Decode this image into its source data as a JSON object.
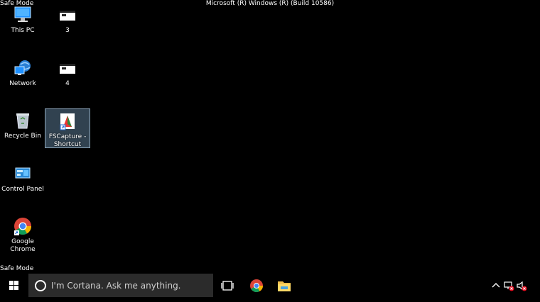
{
  "overlay": {
    "safe_mode_top": "Safe Mode",
    "safe_mode_bottom": "Safe Mode",
    "build": "Microsoft (R) Windows (R) (Build 10586)"
  },
  "desktop": {
    "icons": [
      {
        "label": "This PC",
        "icon": "computer-icon"
      },
      {
        "label": "3",
        "icon": "window-shortcut-icon"
      },
      {
        "label": "Network",
        "icon": "network-icon"
      },
      {
        "label": "4",
        "icon": "window-shortcut-icon"
      },
      {
        "label": "Recycle Bin",
        "icon": "recycle-bin-icon"
      },
      {
        "label": "FSCapture - Shortcut",
        "icon": "fscapture-icon"
      },
      {
        "label": "Control Panel",
        "icon": "control-panel-icon"
      },
      {
        "label": "Google Chrome",
        "icon": "chrome-icon"
      }
    ]
  },
  "taskbar": {
    "cortana_placeholder": "I'm Cortana. Ask me anything.",
    "accent": "#2b2b2b"
  }
}
